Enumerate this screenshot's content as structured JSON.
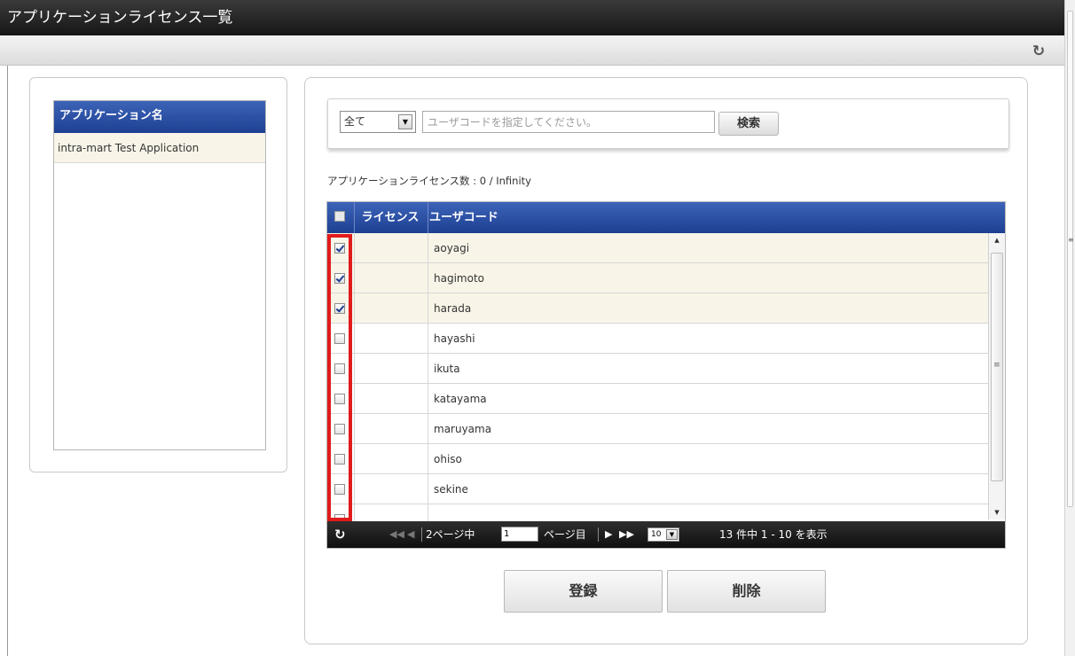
{
  "window": {
    "title": "アプリケーションライセンス一覧"
  },
  "toolbar": {
    "refresh_icon": "refresh-icon"
  },
  "applications": {
    "header": "アプリケーション名",
    "items": [
      {
        "label": "intra-mart Test Application",
        "selected": true
      }
    ]
  },
  "search": {
    "scope": "全て",
    "placeholder": "ユーザコードを指定してください。",
    "value": "",
    "button": "検索"
  },
  "license_count": "アプリケーションライセンス数 : 0 / Infinity",
  "grid": {
    "columns": [
      "ライセンス",
      "ユーザコード"
    ],
    "rows": [
      {
        "license": "",
        "user_code": "aoyagi",
        "checked": true
      },
      {
        "license": "",
        "user_code": "hagimoto",
        "checked": true
      },
      {
        "license": "",
        "user_code": "harada",
        "checked": true
      },
      {
        "license": "",
        "user_code": "hayashi",
        "checked": false
      },
      {
        "license": "",
        "user_code": "ikuta",
        "checked": false
      },
      {
        "license": "",
        "user_code": "katayama",
        "checked": false
      },
      {
        "license": "",
        "user_code": "maruyama",
        "checked": false
      },
      {
        "license": "",
        "user_code": "ohiso",
        "checked": false
      },
      {
        "license": "",
        "user_code": "sekine",
        "checked": false
      },
      {
        "license": "",
        "user_code": "",
        "checked": false
      }
    ]
  },
  "pager": {
    "pages_text": "2ページ中",
    "current_page": "1",
    "page_suffix": "ページ目",
    "page_size": "10",
    "summary": "13 件中 1 - 10 を表示"
  },
  "actions": {
    "register": "登録",
    "delete": "削除"
  },
  "colors": {
    "header_blue": "#2a4ea3",
    "selected_row": "#f8f5e8",
    "highlight_red": "#e11b1b",
    "title_bar": "#222222"
  }
}
